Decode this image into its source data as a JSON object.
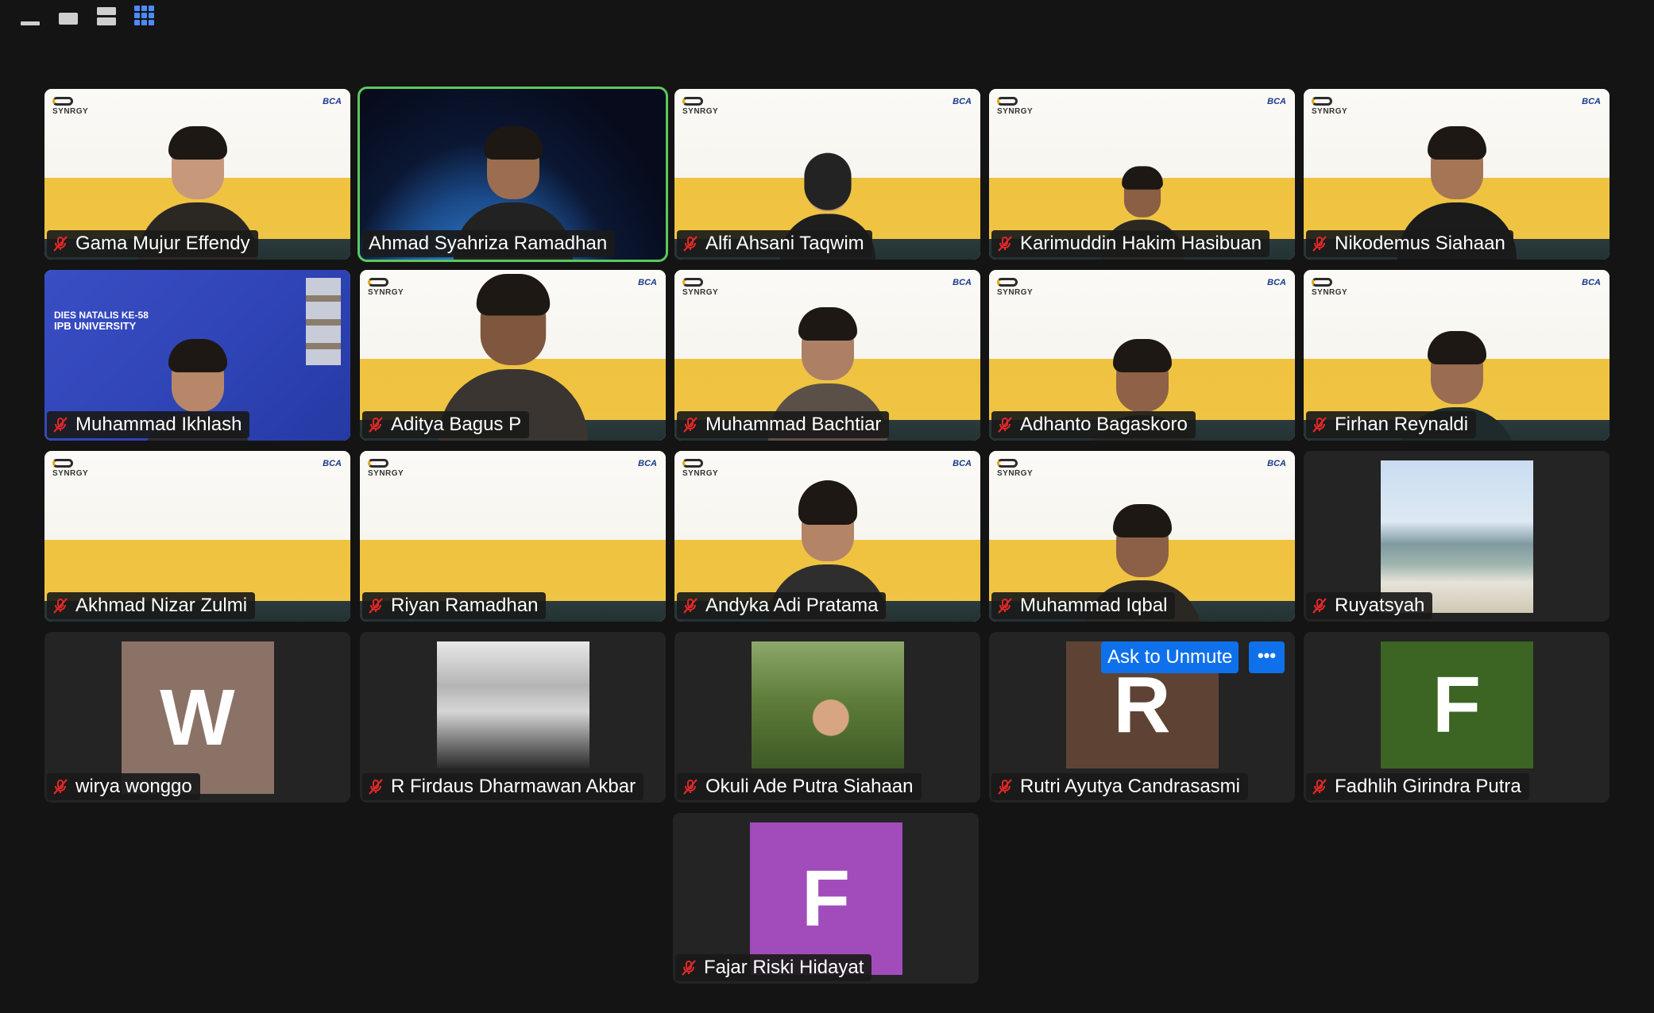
{
  "view_controls": [
    {
      "icon": "minimize-view-icon"
    },
    {
      "icon": "speaker-view-icon"
    },
    {
      "icon": "stacked-view-icon"
    },
    {
      "icon": "gallery-view-icon",
      "active": true,
      "color": "#4a8cff"
    }
  ],
  "participants": [
    {
      "name": "Gama Mujur Effendy",
      "muted": true,
      "background": "brand"
    },
    {
      "name": "Ahmad Syahriza Ramadhan",
      "muted": false,
      "speaking": true,
      "background": "space"
    },
    {
      "name": "Alfi Ahsani Taqwim",
      "muted": true,
      "background": "brand"
    },
    {
      "name": "Karimuddin Hakim Hasibuan",
      "muted": true,
      "background": "brand"
    },
    {
      "name": "Nikodemus Siahaan",
      "muted": true,
      "background": "brand"
    },
    {
      "name": "Muhammad Ikhlash",
      "muted": true,
      "background": "ipb"
    },
    {
      "name": "Aditya Bagus P",
      "muted": true,
      "background": "brand"
    },
    {
      "name": "Muhammad Bachtiar",
      "muted": true,
      "background": "brand"
    },
    {
      "name": "Adhanto Bagaskoro",
      "muted": true,
      "background": "brand"
    },
    {
      "name": "Firhan Reynaldi",
      "muted": true,
      "background": "brand"
    },
    {
      "name": "Akhmad Nizar Zulmi",
      "muted": true,
      "background": "brand"
    },
    {
      "name": "Riyan Ramadhan",
      "muted": true,
      "background": "brand"
    },
    {
      "name": "Andyka Adi Pratama",
      "muted": true,
      "background": "brand"
    },
    {
      "name": "Muhammad Iqbal",
      "muted": true,
      "background": "brand"
    },
    {
      "name": "Ruyatsyah",
      "muted": true,
      "photo": "beach"
    },
    {
      "name": "wirya wonggo",
      "muted": true,
      "initial": "W",
      "color": "#8b7267"
    },
    {
      "name": "R Firdaus Dharmawan Akbar",
      "muted": true,
      "photo": "mono"
    },
    {
      "name": "Okuli Ade Putra Siahaan",
      "muted": true,
      "photo": "forest"
    },
    {
      "name": "Rutri Ayutya Candrasasmi",
      "muted": true,
      "initial": "R",
      "color": "#5e4335"
    },
    {
      "name": "Fadhlih Girindra Putra",
      "muted": true,
      "initial": "F",
      "color": "#3c6422"
    },
    {
      "name": "Fajar Riski Hidayat",
      "muted": true,
      "initial": "F",
      "color": "#a24cbc"
    }
  ],
  "brand": {
    "logo": "SYNRGY",
    "sponsor": "BCA"
  },
  "ipb_background_text": [
    "DIES NATALIS KE-58",
    "IPB UNIVERSITY"
  ],
  "hover_actions": {
    "ask_to_unmute": "Ask to Unmute",
    "more": "•••"
  },
  "colors": {
    "speaking_border": "#5cc85c",
    "muted_icon": "#e02828",
    "action_button": "#0e71eb"
  }
}
